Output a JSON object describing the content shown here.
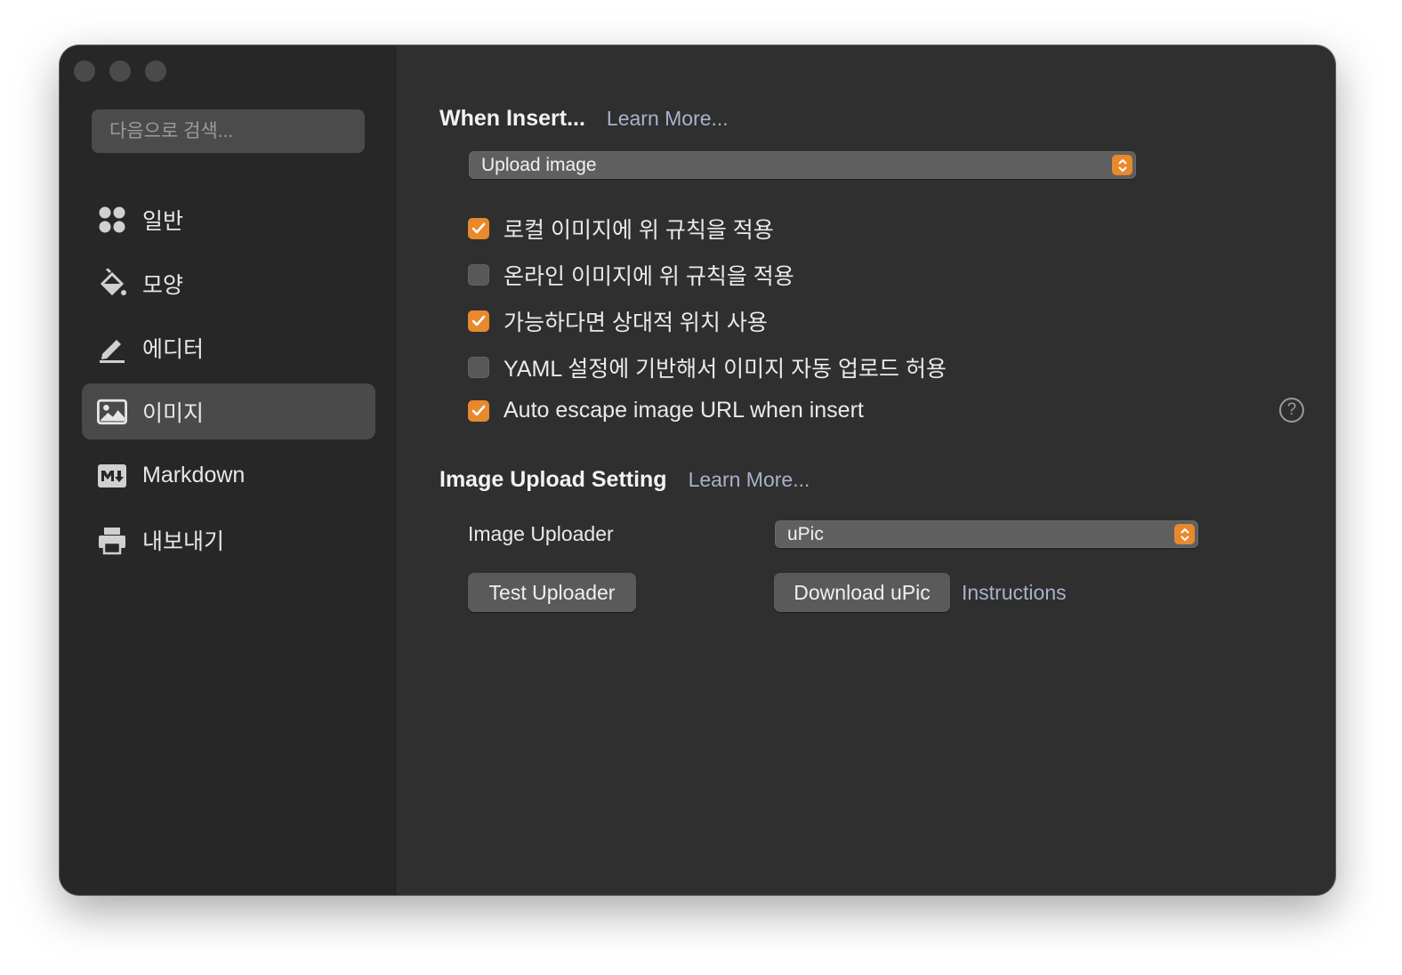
{
  "sidebar": {
    "search": {
      "placeholder": "다음으로 검색..."
    },
    "items": [
      {
        "label": "일반",
        "icon": "grid-icon"
      },
      {
        "label": "모양",
        "icon": "paint-bucket-icon"
      },
      {
        "label": "에디터",
        "icon": "pencil-icon"
      },
      {
        "label": "이미지",
        "icon": "image-icon",
        "active": true
      },
      {
        "label": "Markdown",
        "icon": "markdown-icon"
      },
      {
        "label": "내보내기",
        "icon": "printer-icon"
      }
    ]
  },
  "when_insert": {
    "title": "When Insert...",
    "learn_more": "Learn More...",
    "select_value": "Upload image",
    "options": [
      {
        "label": "로컬 이미지에 위 규칙을 적용",
        "checked": true
      },
      {
        "label": "온라인 이미지에 위 규칙을 적용",
        "checked": false
      },
      {
        "label": "가능하다면 상대적 위치 사용",
        "checked": true
      },
      {
        "label": "YAML 설정에 기반해서 이미지 자동 업로드 허용",
        "checked": false
      },
      {
        "label": "Auto escape image URL when insert",
        "checked": true
      }
    ],
    "help_glyph": "?"
  },
  "upload_setting": {
    "title": "Image Upload Setting",
    "learn_more": "Learn More...",
    "uploader_label": "Image Uploader",
    "uploader_value": "uPic",
    "test_button": "Test Uploader",
    "download_button": "Download uPic",
    "instructions_link": "Instructions"
  },
  "colors": {
    "accent": "#e8892b",
    "window_bg": "#2f2f2f",
    "sidebar_bg": "#272727",
    "link": "#a8b2cc"
  }
}
